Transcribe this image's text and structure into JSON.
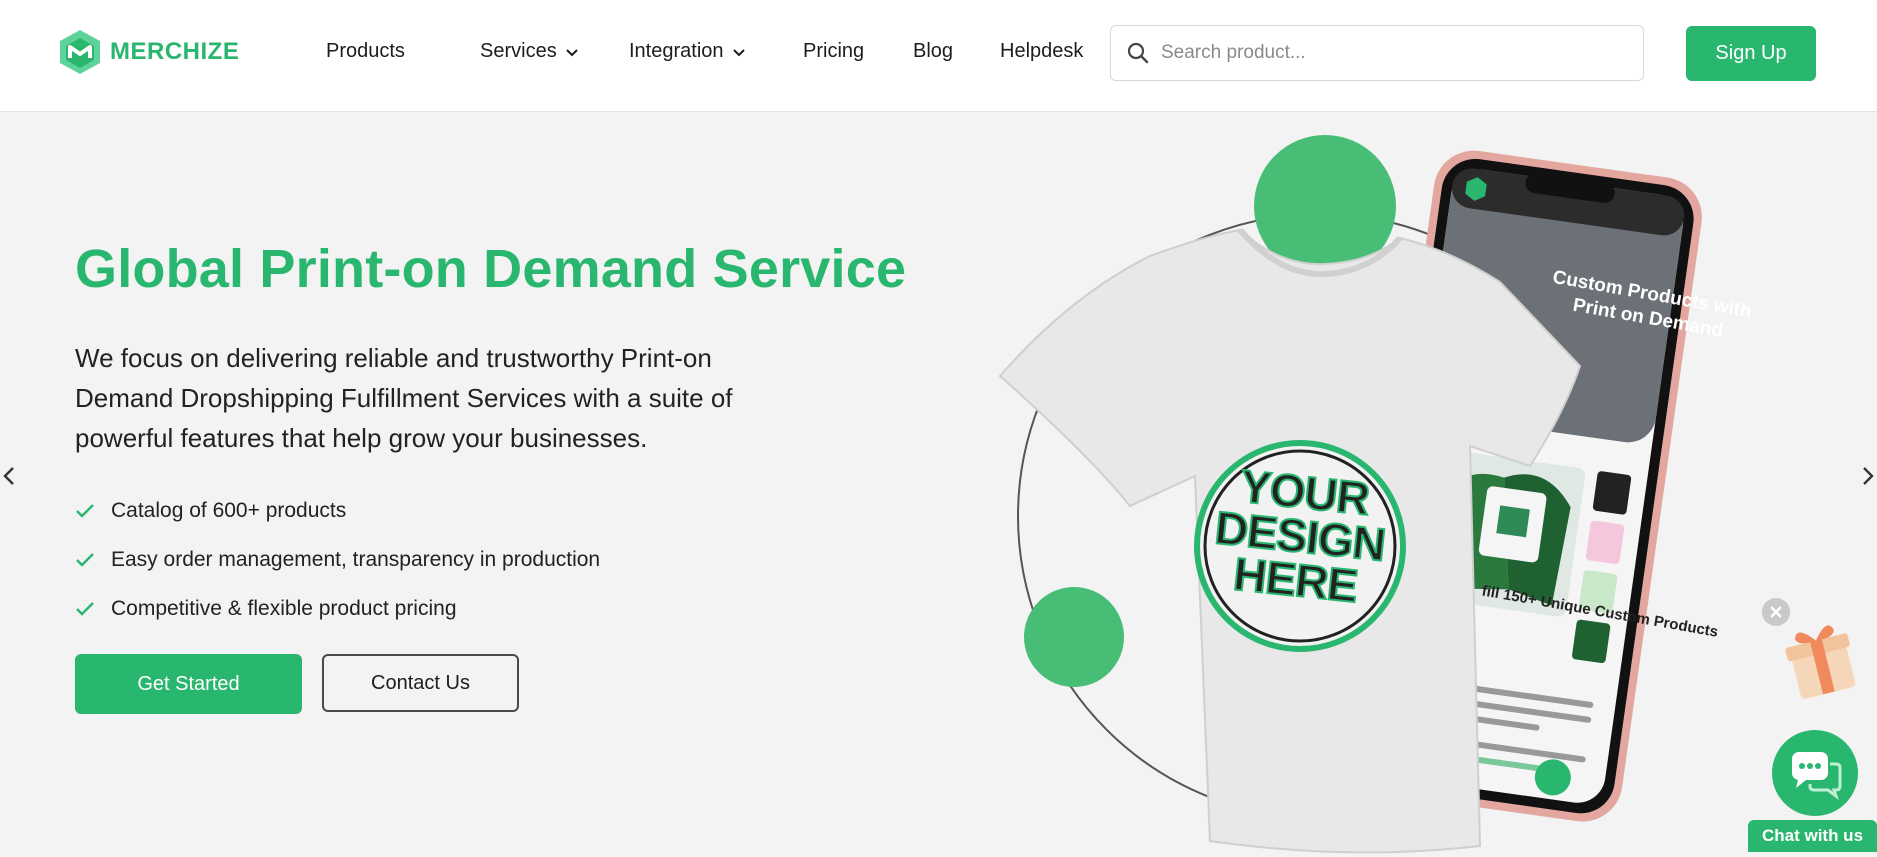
{
  "brand": {
    "name": "MERCHIZE",
    "accent": "#29b66e"
  },
  "nav": {
    "items": [
      {
        "label": "Products",
        "has_dropdown": false
      },
      {
        "label": "Services",
        "has_dropdown": true
      },
      {
        "label": "Integration",
        "has_dropdown": true
      },
      {
        "label": "Pricing",
        "has_dropdown": false
      },
      {
        "label": "Blog",
        "has_dropdown": false
      },
      {
        "label": "Helpdesk",
        "has_dropdown": false
      }
    ]
  },
  "search": {
    "placeholder": "Search product...",
    "value": "",
    "icon": "search-icon"
  },
  "signup": {
    "label": "Sign Up"
  },
  "hero": {
    "title": "Global Print-on Demand Service",
    "description": "We focus on delivering reliable and trustworthy Print-on Demand Dropshipping Fulfillment Services with a suite of powerful features that help grow your businesses.",
    "features": [
      "Catalog of 600+ products",
      "Easy order management, transparency in production",
      "Competitive & flexible product pricing"
    ],
    "primary_cta": "Get Started",
    "secondary_cta": "Contact Us"
  },
  "illustration": {
    "tshirt_text": "YOUR DESIGN HERE",
    "phone_heading": "Custom Products with Print on Demand",
    "phone_subheading": "fill 150+ Unique Custom Products"
  },
  "chat": {
    "label": "Chat with us",
    "icon": "chat-icon"
  },
  "gift": {
    "icon": "gift-icon",
    "close_icon": "close-icon"
  }
}
